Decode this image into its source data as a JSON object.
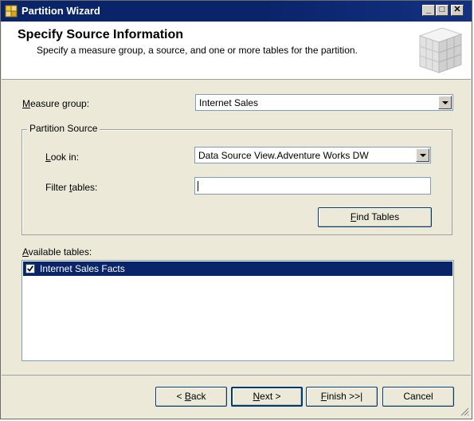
{
  "window": {
    "title": "Partition Wizard",
    "minimize_glyph": "_",
    "maximize_glyph": "□",
    "close_glyph": "✕"
  },
  "header": {
    "title": "Specify Source Information",
    "subtitle": "Specify a measure group, a source, and one or more tables for the partition.",
    "graphic_icon": "cube-grid-icon"
  },
  "measure_group": {
    "label_key": "M",
    "label_rest": "easure group:",
    "value": "Internet Sales"
  },
  "partition_source": {
    "group_title": "Partition Source",
    "look_in_key": "L",
    "look_in_rest": "ook in:",
    "look_in_value": "Data Source View.Adventure Works DW",
    "filter_pre": "Filter ",
    "filter_key": "t",
    "filter_post": "ables:",
    "filter_value": "",
    "find_key": "F",
    "find_rest": "ind Tables"
  },
  "available_tables": {
    "label_key": "A",
    "label_rest": "vailable tables:",
    "items": [
      {
        "label": "Internet Sales Facts",
        "checked": true,
        "selected": true
      }
    ]
  },
  "footer": {
    "back_pre": "< ",
    "back_key": "B",
    "back_rest": "ack",
    "next_key": "N",
    "next_rest": "ext >",
    "finish_key": "F",
    "finish_rest": "inish >>|",
    "cancel_label": "Cancel"
  },
  "colors": {
    "titlebar": "#0a246a",
    "selection": "#0a246a",
    "dialog_bg": "#ece9d8"
  }
}
